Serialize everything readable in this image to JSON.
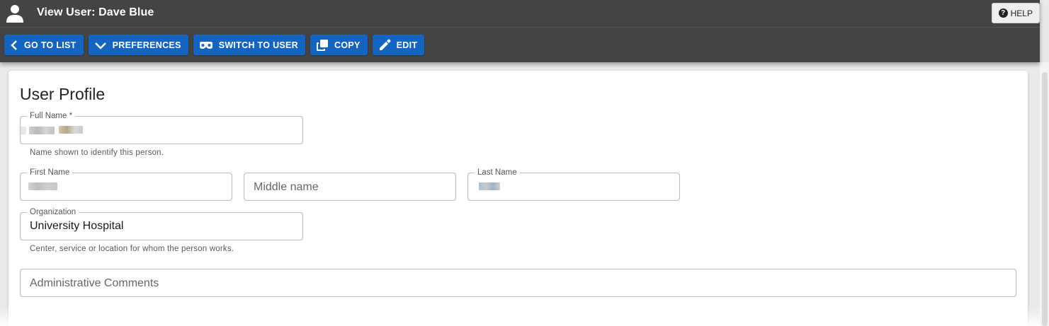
{
  "header": {
    "title": "View User: Dave Blue",
    "help_label": "HELP"
  },
  "toolbar": {
    "go_to_list": "GO TO LIST",
    "preferences": "PREFERENCES",
    "switch_to_user": "SWITCH TO USER",
    "copy": "COPY",
    "edit": "EDIT"
  },
  "profile": {
    "title": "User Profile",
    "full_name": {
      "label": "Full Name *",
      "helper": "Name shown to identify this person."
    },
    "first_name": {
      "label": "First Name"
    },
    "middle_name": {
      "placeholder": "Middle name"
    },
    "last_name": {
      "label": "Last Name"
    },
    "organization": {
      "label": "Organization",
      "value": "University Hospital",
      "helper": "Center, service or location for whom the person works."
    },
    "admin_comments": {
      "placeholder": "Administrative Comments"
    }
  },
  "colors": {
    "header_bg": "#444444",
    "button_blue": "#1565c0",
    "card_bg": "#ffffff"
  },
  "icons": [
    "user-icon",
    "help-icon",
    "chevron-left-icon",
    "chevron-down-icon",
    "mask-icon",
    "copy-icon",
    "pencil-icon"
  ]
}
